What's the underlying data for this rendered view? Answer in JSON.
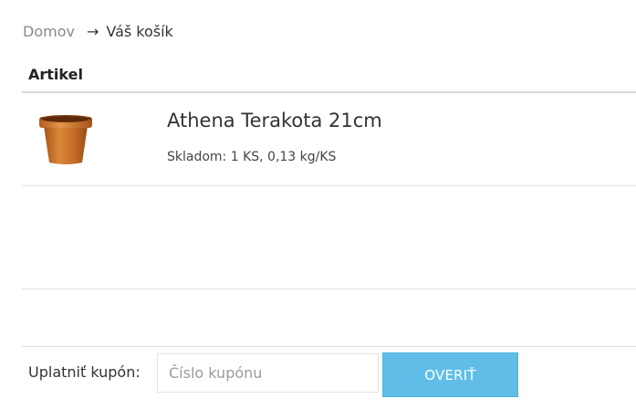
{
  "breadcrumb": {
    "home": "Domov",
    "arrow": "→",
    "current": "Váš košík"
  },
  "table": {
    "header_item": "Artikel"
  },
  "cart_items": [
    {
      "name": "Athena Terakota 21cm",
      "stock": "Skladom: 1 KS, 0,13 kg/KS",
      "thumb_icon": "terracotta-pot-icon"
    }
  ],
  "coupon": {
    "label": "Uplatniť kupón:",
    "placeholder": "Číslo kupónu",
    "value": "",
    "button_label": "OVERIŤ"
  },
  "colors": {
    "button_bg": "#60bde8",
    "pot": "#c8712a"
  }
}
